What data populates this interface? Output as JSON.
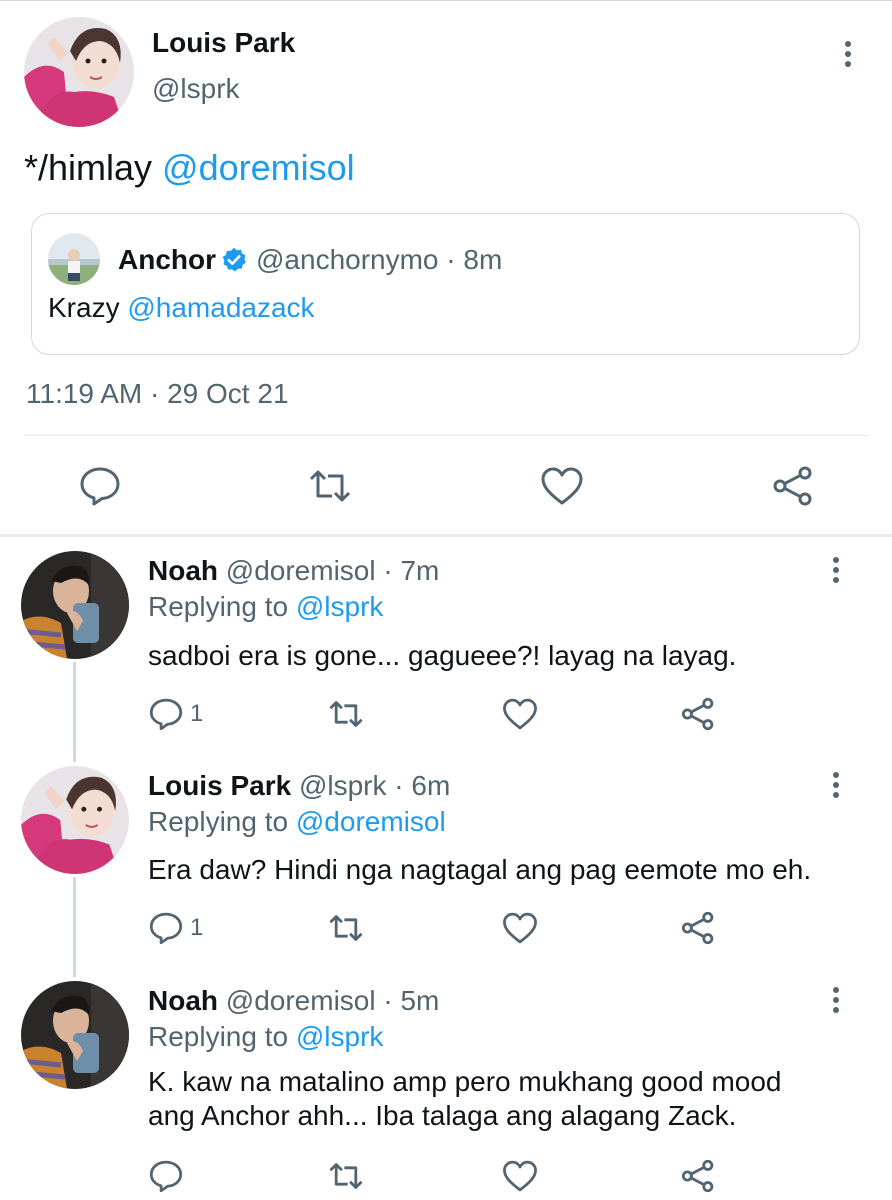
{
  "main_tweet": {
    "author_name": "Louis Park",
    "author_handle": "@lsprk",
    "text_prefix": "*/himlay ",
    "text_mention": "@doremisol",
    "quoted": {
      "name": "Anchor",
      "handle_time": "@anchornymo · 8m",
      "text_prefix": "Krazy ",
      "text_mention": "@hamadazack"
    },
    "timestamp": "11:19 AM · 29 Oct 21"
  },
  "replies": [
    {
      "name": "Noah",
      "handle_time": "@doremisol · 7m",
      "replying_label": "Replying to ",
      "replying_to": "@lsprk",
      "text_lines": [
        "sadboi era is gone... gagueee?! layag na layag."
      ],
      "reply_count": "1"
    },
    {
      "name": "Louis Park",
      "handle_time": "@lsprk · 6m",
      "replying_label": "Replying to ",
      "replying_to": "@doremisol",
      "text_lines": [
        "Era daw? Hindi nga nagtagal ang pag eemote mo eh."
      ],
      "reply_count": "1"
    },
    {
      "name": "Noah",
      "handle_time": "@doremisol · 5m",
      "replying_label": "Replying to ",
      "replying_to": "@lsprk",
      "text_lines": [
        "K. kaw na matalino amp pero mukhang good mood",
        "ang Anchor ahh... Iba talaga ang alagang Zack."
      ],
      "reply_count": ""
    }
  ],
  "icons": {
    "reply": "speech-bubble-icon",
    "retweet": "retweet-arrows-icon",
    "like": "heart-icon",
    "share": "share-nodes-icon",
    "more": "vertical-dots-icon",
    "verified": "verified-badge-icon"
  },
  "colors": {
    "link": "#1d9bf0",
    "muted": "#536471",
    "avatar_pink": "#d63a7c",
    "verified_blue": "#1d9bf0"
  }
}
